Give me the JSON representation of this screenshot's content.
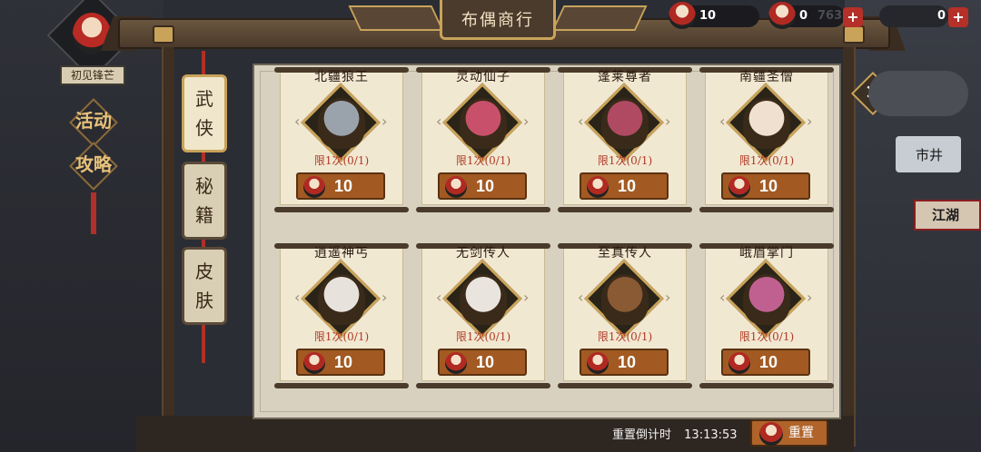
{
  "header": {
    "shop_title": "布偶商行",
    "player_title": "初见锋芒",
    "event_label_1": "活动",
    "event_label_2": "攻略"
  },
  "currency": [
    {
      "icon": "puppet-token-icon",
      "value": "10"
    },
    {
      "icon": "puppet-head-icon",
      "value": "0"
    },
    {
      "icon": "",
      "value": "763"
    },
    {
      "icon": "",
      "value": "0"
    }
  ],
  "tabs": [
    {
      "label_1": "武",
      "label_2": "侠",
      "active": true
    },
    {
      "label_1": "秘",
      "label_2": "籍",
      "active": false
    },
    {
      "label_1": "皮",
      "label_2": "肤",
      "active": false
    }
  ],
  "items": [
    {
      "name": "北疆狼王",
      "limit": "限1次(0/1)",
      "price": "10",
      "portrait_color": "#9aa3ab"
    },
    {
      "name": "灵动仙子",
      "limit": "限1次(0/1)",
      "price": "10",
      "portrait_color": "#c9506a"
    },
    {
      "name": "蓬莱尊者",
      "limit": "限1次(0/1)",
      "price": "10",
      "portrait_color": "#b04a62"
    },
    {
      "name": "南疆圣僧",
      "limit": "限1次(0/1)",
      "price": "10",
      "portrait_color": "#f0e0d0"
    },
    {
      "name": "逍遥神丐",
      "limit": "限1次(0/1)",
      "price": "10",
      "portrait_color": "#e8e2dc"
    },
    {
      "name": "无剑传人",
      "limit": "限1次(0/1)",
      "price": "10",
      "portrait_color": "#e9e4dd"
    },
    {
      "name": "至真传人",
      "limit": "限1次(0/1)",
      "price": "10",
      "portrait_color": "#8a5a34"
    },
    {
      "name": "峨眉掌门",
      "limit": "限1次(0/1)",
      "price": "10",
      "portrait_color": "#c06090"
    }
  ],
  "reset": {
    "timer_label": "重置倒计时",
    "timer_value": "13:13:53",
    "button_label": "重置"
  },
  "map": {
    "label_1": "市井",
    "label_2": "江湖"
  }
}
